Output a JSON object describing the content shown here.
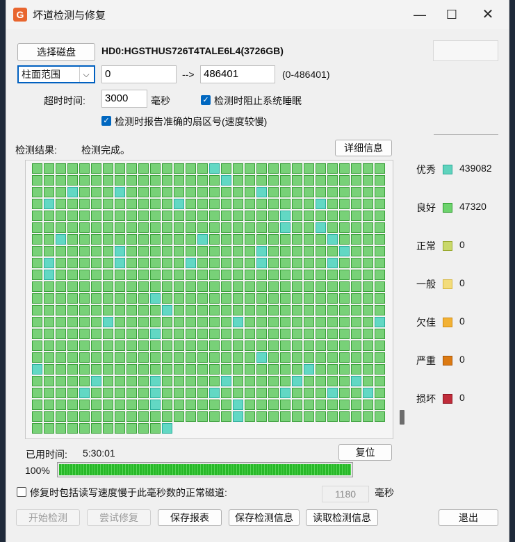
{
  "window": {
    "app_icon": "G",
    "title": "坏道检测与修复",
    "minimize_glyph": "—",
    "maximize_glyph": "☐",
    "close_glyph": "✕"
  },
  "disk": {
    "select_button": "选择磁盘",
    "name": "HD0:HGSTHUS726T4TALE6L4(3726GB)"
  },
  "range": {
    "mode": "柱面范围",
    "start": "0",
    "arrow": "-->",
    "end": "486401",
    "hint": "(0-486401)"
  },
  "timeout": {
    "label": "超时时间:",
    "value": "3000",
    "unit": "毫秒"
  },
  "options": {
    "prevent_sleep": {
      "label": "检测时阻止系统睡眠",
      "checked": true
    },
    "report_sector": {
      "label": "检测时报告准确的扇区号(速度较慢)",
      "checked": true
    },
    "repair_slow": {
      "label": "修复时包括读写速度慢于此毫秒数的正常磁道:",
      "checked": false,
      "value": "1180",
      "unit": "毫秒"
    }
  },
  "result": {
    "label": "检测结果:",
    "status": "检测完成。",
    "details_button": "详细信息"
  },
  "legend": [
    {
      "label": "优秀",
      "count": "439082",
      "color": "#5fd3bd",
      "border": "#2aa896"
    },
    {
      "label": "良好",
      "count": "47320",
      "color": "#6dd36d",
      "border": "#2f9b2f"
    },
    {
      "label": "正常",
      "count": "0",
      "color": "#c9d86a",
      "border": "#9aaa30"
    },
    {
      "label": "一般",
      "count": "0",
      "color": "#f3dc7a",
      "border": "#d6b640"
    },
    {
      "label": "欠佳",
      "count": "0",
      "color": "#f2b134",
      "border": "#cf8a12"
    },
    {
      "label": "严重",
      "count": "0",
      "color": "#dc7a12",
      "border": "#a45408"
    },
    {
      "label": "损坏",
      "count": "0",
      "color": "#c02c3a",
      "border": "#8e1622"
    }
  ],
  "grid": {
    "good_color": "#78d178",
    "good_border": "#3aa03a",
    "excellent_color": "#62d8c4",
    "excellent_border": "#2aae9a"
  },
  "elapsed": {
    "label": "已用时间:",
    "value": "5:30:01",
    "reset_button": "复位"
  },
  "progress": {
    "percent_label": "100%",
    "fraction": 1.0
  },
  "footer": {
    "start_button": "开始检测",
    "try_repair_button": "尝试修复",
    "save_report_button": "保存报表",
    "save_info_button": "保存检测信息",
    "read_info_button": "读取检测信息",
    "exit_button": "退出"
  }
}
